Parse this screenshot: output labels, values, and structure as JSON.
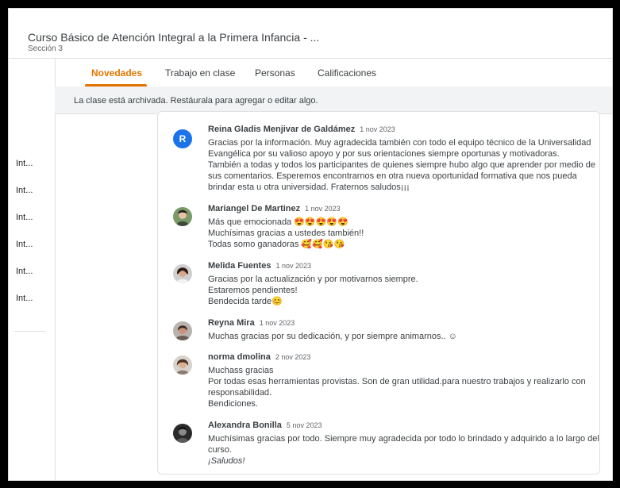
{
  "header": {
    "course_title": "Curso Básico de Atención Integral a la Primera Infancia - ...",
    "section": "Sección 3"
  },
  "tabs": [
    {
      "label": "Novedades",
      "active": true
    },
    {
      "label": "Trabajo en clase",
      "active": false
    },
    {
      "label": "Personas",
      "active": false
    },
    {
      "label": "Calificaciones",
      "active": false
    }
  ],
  "banner": {
    "text": "La clase está archivada. Restáurala para agregar o editar algo."
  },
  "topics": [
    "Int...",
    "Int...",
    "Int...",
    "Int...",
    "Int...",
    "Int..."
  ],
  "comments": [
    {
      "author": "Reina Gladis Menjivar de Galdámez",
      "date": "1 nov 2023",
      "avatar_letter": "R",
      "lines": [
        "Gracias por la información. Muy agradecida  también con todo el equipo  técnico  de la Universalidad",
        "Evangélica por su  valioso apoyo y por sus orientaciones siempre  oportunas y  motivadoras.",
        "También a todas y  todos los participantes de quienes  siempre hubo algo que aprender  por medio de",
        "sus comentarios. Esperemos encontrarnos en otra nueva oportunidad formativa   que nos pueda",
        "brindar esta u otra universidad. Fraternos saludos¡¡¡"
      ]
    },
    {
      "author": "Mariangel De Martinez",
      "date": "1 nov 2023",
      "lines": [
        "Más que emocionada 😍😍😍😍😍",
        "Muchísimas gracias a ustedes también!!",
        "Todas somo ganadoras 🥰🥰😘😘"
      ]
    },
    {
      "author": "Melida Fuentes",
      "date": "1 nov 2023",
      "lines": [
        "Gracias por la actualización y por motivarnos siempre.",
        "Estaremos pendientes!",
        "Bendecida tarde😊"
      ]
    },
    {
      "author": "Reyna Mira",
      "date": "1 nov 2023",
      "lines": [
        "Muchas gracias por su dedicación, y por siempre animarnos.. ☺"
      ]
    },
    {
      "author": "norma dmolina",
      "date": "2 nov 2023",
      "lines": [
        "Muchass gracias",
        "Por todas esas herramientas provistas. Son de gran utilidad.para nuestro trabajos y realizarlo con",
        "responsabilidad.",
        "Bendiciones."
      ]
    },
    {
      "author": "Alexandra Bonilla",
      "date": "5 nov 2023",
      "lines": [
        "Muchísimas gracias por todo. Siempre muy agradecida por todo lo brindado y adquirido a lo largo del",
        "curso.",
        "¡Saludos!"
      ]
    }
  ]
}
